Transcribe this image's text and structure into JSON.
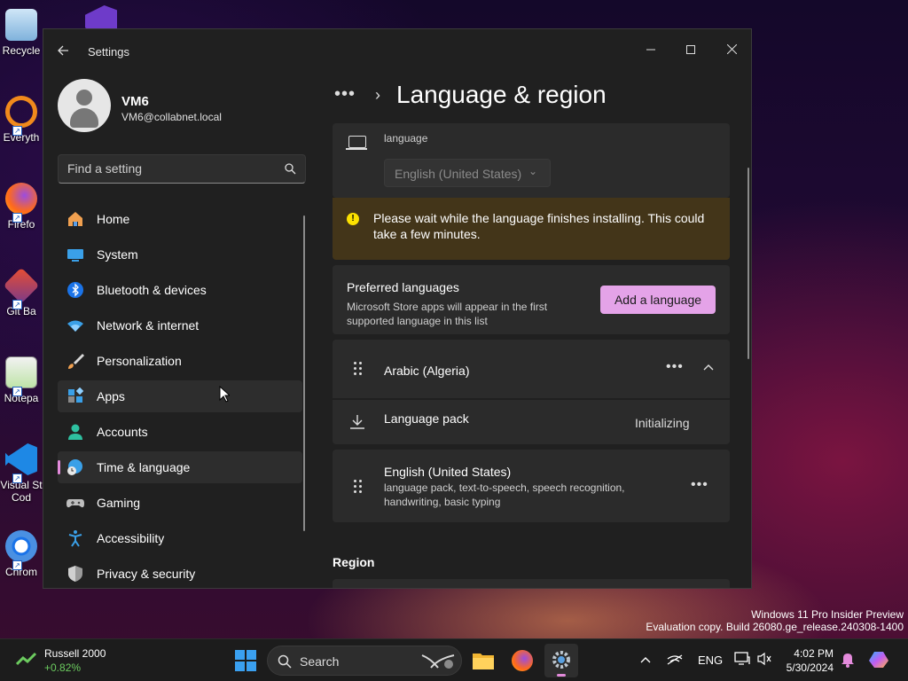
{
  "desktop": {
    "icons": [
      {
        "label": "Recycle",
        "name": "recycle-bin"
      },
      {
        "label": "Everyth",
        "name": "everything"
      },
      {
        "label": "Firefo",
        "name": "firefox"
      },
      {
        "label": "Git Ba",
        "name": "git-bash"
      },
      {
        "label": "Notepa",
        "name": "notepad"
      },
      {
        "label": "Visual St",
        "label2": "Cod",
        "name": "vscode"
      },
      {
        "label": "Chrom",
        "name": "chrome"
      }
    ],
    "watermark_line1": "Windows 11 Pro Insider Preview",
    "watermark_line2": "Evaluation copy. Build 26080.ge_release.240308-1400"
  },
  "window": {
    "title": "Settings",
    "back_icon": "arrow-left-icon",
    "minimize_icon": "minimize-icon",
    "maximize_icon": "maximize-icon",
    "close_icon": "close-icon"
  },
  "user": {
    "name": "VM6",
    "email": "VM6@collabnet.local"
  },
  "search": {
    "placeholder": "Find a setting"
  },
  "sidebar": {
    "items": [
      {
        "label": "Home",
        "icon": "home-icon"
      },
      {
        "label": "System",
        "icon": "system-icon"
      },
      {
        "label": "Bluetooth & devices",
        "icon": "bluetooth-icon"
      },
      {
        "label": "Network & internet",
        "icon": "wifi-icon"
      },
      {
        "label": "Personalization",
        "icon": "brush-icon"
      },
      {
        "label": "Apps",
        "icon": "apps-icon"
      },
      {
        "label": "Accounts",
        "icon": "accounts-icon"
      },
      {
        "label": "Time & language",
        "icon": "globe-clock-icon"
      },
      {
        "label": "Gaming",
        "icon": "gamepad-icon"
      },
      {
        "label": "Accessibility",
        "icon": "accessibility-icon"
      },
      {
        "label": "Privacy & security",
        "icon": "shield-icon"
      }
    ],
    "active": "Time & language",
    "hovered": "Apps"
  },
  "main": {
    "breadcrumb_more": "•••",
    "breadcrumb_sep": "›",
    "title": "Language & region",
    "display_language": {
      "desc": "language",
      "value": "English (United States)",
      "chevron": "⌄"
    },
    "warning": {
      "icon": "!",
      "text": "Please wait while the language finishes installing. This could take a few minutes."
    },
    "preferred": {
      "title": "Preferred languages",
      "desc": "Microsoft Store apps will appear in the first supported language in this list",
      "add_button": "Add a language"
    },
    "languages": [
      {
        "name": "Arabic (Algeria)",
        "more": "•••",
        "expand": "^"
      },
      {
        "name": "English (United States)",
        "more": "•••",
        "features": "language pack, text-to-speech, speech recognition, handwriting, basic typing"
      }
    ],
    "language_pack": {
      "label": "Language pack",
      "status": "Initializing"
    },
    "region_header": "Region"
  },
  "taskbar": {
    "ticker_name": "Russell 2000",
    "ticker_change": "+0.82%",
    "search_label": "Search",
    "lang": "ENG",
    "time": "4:02 PM",
    "date": "5/30/2024",
    "accent": "#e48bdc",
    "apps": [
      "start-icon",
      "file-explorer-icon",
      "firefox-icon",
      "settings-icon"
    ]
  }
}
